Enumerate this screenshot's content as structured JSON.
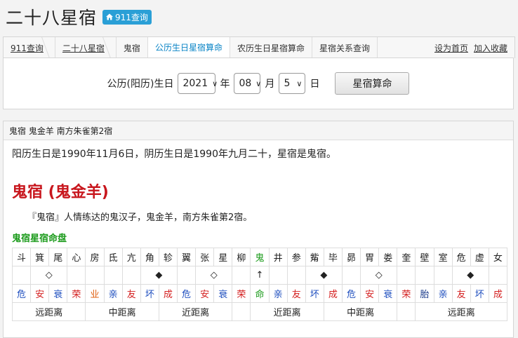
{
  "header": {
    "title": "二十八星宿",
    "badge": "911查询",
    "badge_icon": "home-icon"
  },
  "nav": {
    "tabs": [
      {
        "label": "911查询",
        "underline": true
      },
      {
        "label": "二十八星宿",
        "underline": true
      },
      {
        "label": "鬼宿",
        "underline": false
      },
      {
        "label": "公历生日星宿算命",
        "active": true
      },
      {
        "label": "农历生日星宿算命"
      },
      {
        "label": "星宿关系查询"
      }
    ],
    "right_links": [
      "设为首页",
      "加入收藏"
    ]
  },
  "form": {
    "label": "公历(阳历)生日",
    "year": "2021",
    "year_unit": "年",
    "month": "08",
    "month_unit": "月",
    "day": "5",
    "day_unit": "日",
    "submit": "星宿算命"
  },
  "result": {
    "header": "鬼宿 鬼金羊 南方朱雀第2宿",
    "summary": "阳历生日是1990年11月6日，阴历生日是1990年九月二十，星宿是鬼宿。",
    "title": "鬼宿 (鬼金羊)",
    "description": "『鬼宿』人情练达的鬼汉子，鬼金羊，南方朱雀第2宿。",
    "chart_title": "鬼宿星宿命盘",
    "stars": [
      "斗",
      "箕",
      "尾",
      "心",
      "房",
      "氐",
      "亢",
      "角",
      "轸",
      "翼",
      "张",
      "星",
      "柳",
      "鬼",
      "井",
      "参",
      "觜",
      "毕",
      "昴",
      "胃",
      "娄",
      "奎",
      "壁",
      "室",
      "危",
      "虚",
      "女"
    ],
    "markers": [
      {
        "col": 1,
        "span": 2,
        "symbol": "◇"
      },
      {
        "col": 7,
        "span": 2,
        "symbol": "◆"
      },
      {
        "col": 10,
        "span": 2,
        "symbol": "◇"
      },
      {
        "col": 13,
        "span": 1,
        "symbol": "↑"
      },
      {
        "col": 16,
        "span": 2,
        "symbol": "◆"
      },
      {
        "col": 19,
        "span": 2,
        "symbol": "◇"
      },
      {
        "col": 24,
        "span": 2,
        "symbol": "◆"
      }
    ],
    "relations": [
      "危",
      "安",
      "衰",
      "荣",
      "业",
      "亲",
      "友",
      "坏",
      "成",
      "危",
      "安",
      "衰",
      "荣",
      "命",
      "亲",
      "友",
      "坏",
      "成",
      "危",
      "安",
      "衰",
      "荣",
      "胎",
      "亲",
      "友",
      "坏",
      "成"
    ],
    "relation_colors": [
      "blue",
      "red",
      "blue",
      "red",
      "orange",
      "blue",
      "red",
      "blue",
      "red",
      "blue",
      "red",
      "blue",
      "red",
      "green",
      "blue",
      "red",
      "blue",
      "red",
      "blue",
      "red",
      "blue",
      "red",
      "navy",
      "blue",
      "red",
      "blue",
      "red"
    ],
    "distances": [
      {
        "label": "远距离",
        "span": 4
      },
      {
        "label": "中距离",
        "span": 4
      },
      {
        "label": "近距离",
        "span": 4
      },
      {
        "label": "",
        "span": 1
      },
      {
        "label": "近距离",
        "span": 4
      },
      {
        "label": "中距离",
        "span": 4
      },
      {
        "label": "",
        "span": 1
      },
      {
        "label": "远距离",
        "span": 5
      }
    ]
  }
}
